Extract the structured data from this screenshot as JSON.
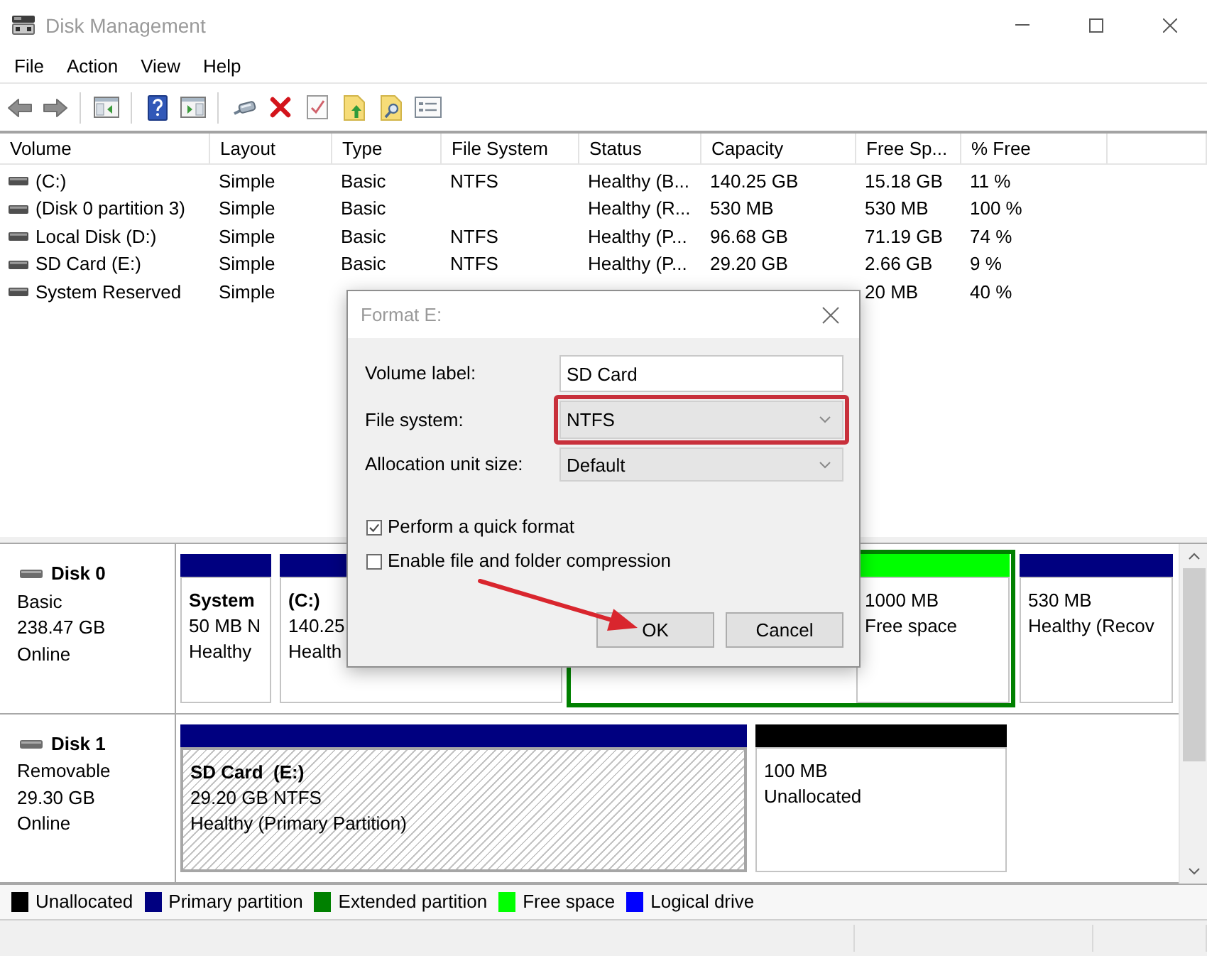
{
  "window": {
    "title": "Disk Management"
  },
  "menu": [
    "File",
    "Action",
    "View",
    "Help"
  ],
  "volume_table": {
    "columns": [
      "Volume",
      "Layout",
      "Type",
      "File System",
      "Status",
      "Capacity",
      "Free Sp...",
      "% Free"
    ],
    "rows": [
      [
        "(C:)",
        "Simple",
        "Basic",
        "NTFS",
        "Healthy (B...",
        "140.25 GB",
        "15.18 GB",
        "11 %"
      ],
      [
        "(Disk 0 partition 3)",
        "Simple",
        "Basic",
        null,
        "Healthy (R...",
        "530 MB",
        "530 MB",
        "100 %"
      ],
      [
        "Local Disk (D:)",
        "Simple",
        "Basic",
        "NTFS",
        "Healthy (P...",
        "96.68 GB",
        "71.19 GB",
        "74 %"
      ],
      [
        "SD Card (E:)",
        "Simple",
        "Basic",
        "NTFS",
        "Healthy (P...",
        "29.20 GB",
        "2.66 GB",
        "9 %"
      ],
      [
        "System Reserved",
        "Simple",
        null,
        null,
        null,
        null,
        "20 MB",
        "40 %"
      ]
    ]
  },
  "disks": [
    {
      "name": "Disk 0",
      "type": "Basic",
      "size": "238.47 GB",
      "status": "Online",
      "partitions": [
        {
          "kind": "partition",
          "color": "#000080",
          "title": "System",
          "size": "50 MB N",
          "status": "Healthy",
          "selected": false
        },
        {
          "kind": "partition",
          "color": "#000080",
          "title": "(C:)",
          "size": "140.25",
          "status": "Health",
          "selected": false
        },
        {
          "kind": "extended",
          "color": "#008000",
          "selected": false,
          "children": [
            {
              "color": "#00ff00",
              "size": "1000 MB",
              "status": "Free space",
              "selected": false
            }
          ]
        },
        {
          "kind": "partition",
          "color": "#000080",
          "size": "530 MB",
          "status": "Healthy (Recov",
          "selected": false
        }
      ]
    },
    {
      "name": "Disk 1",
      "type": "Removable",
      "size": "29.30 GB",
      "status": "Online",
      "partitions": [
        {
          "kind": "partition",
          "color": "#000080",
          "title": "SD Card  (E:)",
          "size": "29.20 GB NTFS",
          "status": "Healthy (Primary Partition)",
          "selected": true
        },
        {
          "kind": "partition",
          "color": "#000000",
          "size": "100 MB",
          "status": "Unallocated",
          "selected": false
        }
      ]
    }
  ],
  "legend": [
    {
      "label": "Unallocated",
      "color": "#000000"
    },
    {
      "label": "Primary partition",
      "color": "#000080"
    },
    {
      "label": "Extended partition",
      "color": "#008000"
    },
    {
      "label": "Free space",
      "color": "#00ff00"
    },
    {
      "label": "Logical drive",
      "color": "#0000ff"
    }
  ],
  "format_dialog": {
    "title": "Format E:",
    "fields": [
      {
        "kind": "text",
        "label": "Volume label:",
        "value": "SD Card",
        "highlighted": false
      },
      {
        "kind": "select",
        "label": "File system:",
        "value": "NTFS",
        "highlighted": true
      },
      {
        "kind": "select",
        "label": "Allocation unit size:",
        "value": "Default",
        "highlighted": false
      }
    ],
    "options": [
      {
        "label": "Perform a quick format",
        "checked": true
      },
      {
        "label": "Enable file and folder compression",
        "checked": false
      }
    ],
    "buttons": [
      {
        "label": "OK",
        "annotated": true
      },
      {
        "label": "Cancel",
        "annotated": false
      }
    ]
  }
}
